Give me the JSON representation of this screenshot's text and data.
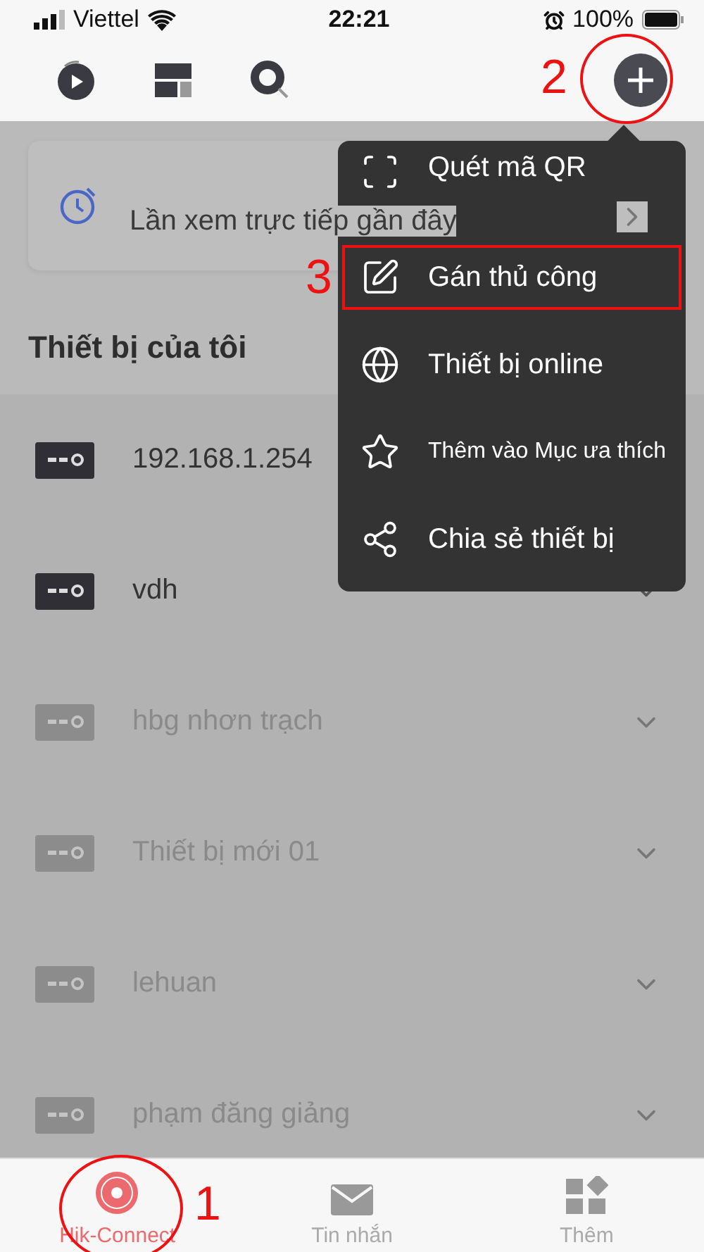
{
  "status_bar": {
    "carrier": "Viettel",
    "time": "22:21",
    "battery": "100%"
  },
  "recent_card": {
    "label": "Lần xem trực tiếp gần đây"
  },
  "section_title": "Thiết bị của tôi",
  "devices": [
    {
      "name": "192.168.1.254",
      "online": true
    },
    {
      "name": "vdh",
      "online": true
    },
    {
      "name": "hbg nhơn trạch",
      "online": false
    },
    {
      "name": "Thiết bị mới 01",
      "online": false
    },
    {
      "name": "lehuan",
      "online": false
    },
    {
      "name": "phạm đăng giảng",
      "online": false
    }
  ],
  "add_menu": [
    {
      "kind": "scan",
      "label": "Quét mã QR",
      "highlighted": false
    },
    {
      "kind": "edit",
      "label": "Gán thủ công",
      "highlighted": true
    },
    {
      "kind": "globe",
      "label": "Thiết bị online",
      "highlighted": false
    },
    {
      "kind": "star",
      "label": "Thêm vào Mục ưa thích",
      "highlighted": false
    },
    {
      "kind": "share",
      "label": "Chia sẻ thiết bị",
      "highlighted": false
    }
  ],
  "tab_bar": [
    {
      "kind": "live",
      "label": "Hik-Connect",
      "selected": true
    },
    {
      "kind": "message",
      "label": "Tin nhắn",
      "selected": false
    },
    {
      "kind": "more",
      "label": "Thêm",
      "selected": false
    }
  ],
  "annotations": [
    {
      "label": "1"
    },
    {
      "label": "2"
    },
    {
      "label": "3"
    }
  ]
}
